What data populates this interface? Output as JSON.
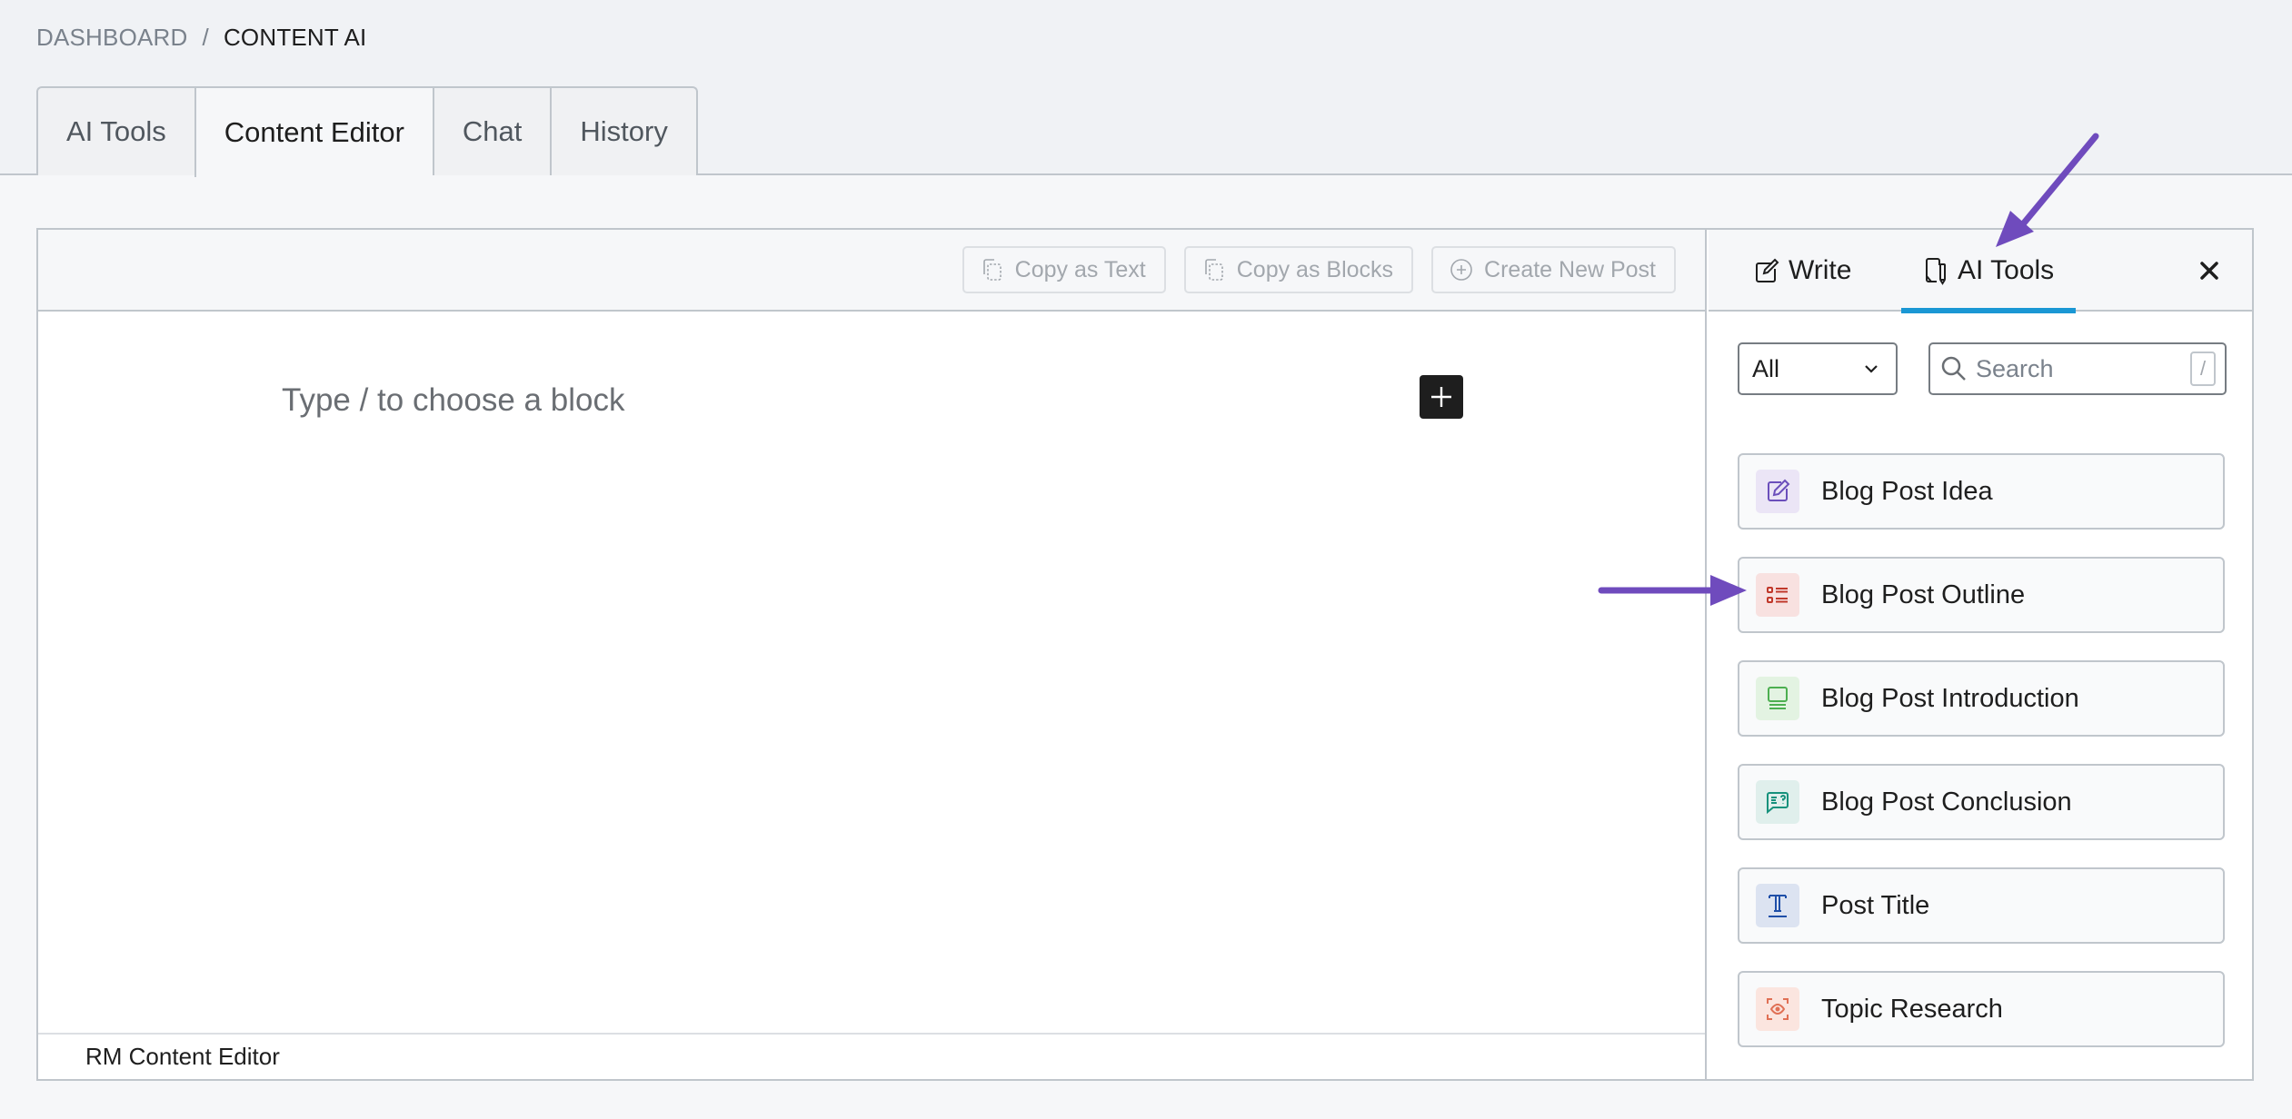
{
  "breadcrumb": {
    "parent": "DASHBOARD",
    "separator": "/",
    "current": "CONTENT AI"
  },
  "tabs": [
    {
      "label": "AI Tools",
      "active": false
    },
    {
      "label": "Content Editor",
      "active": true
    },
    {
      "label": "Chat",
      "active": false
    },
    {
      "label": "History",
      "active": false
    }
  ],
  "editor": {
    "toolbar": {
      "copy_text": "Copy as Text",
      "copy_blocks": "Copy as Blocks",
      "create_post": "Create New Post"
    },
    "placeholder": "Type / to choose a block",
    "add_block_icon": "plus-icon",
    "footer": "RM Content Editor"
  },
  "sidebar": {
    "tabs": {
      "write": "Write",
      "ai_tools": "AI Tools",
      "active": "ai_tools"
    },
    "close_icon": "close-icon",
    "filter": {
      "selected": "All"
    },
    "search": {
      "placeholder": "Search",
      "value": "",
      "shortcut": "/"
    },
    "tools": [
      {
        "label": "Blog Post Idea",
        "icon": "edit-square-icon",
        "color": "#6b4fbb",
        "bg": "#ebe5f6"
      },
      {
        "label": "Blog Post Outline",
        "icon": "list-icon",
        "color": "#c0392b",
        "bg": "#f8e1e0"
      },
      {
        "label": "Blog Post Introduction",
        "icon": "intro-screen-icon",
        "color": "#4caf50",
        "bg": "#e3f3e2"
      },
      {
        "label": "Blog Post Conclusion",
        "icon": "chat-question-icon",
        "color": "#16917c",
        "bg": "#e0efec"
      },
      {
        "label": "Post Title",
        "icon": "text-title-icon",
        "color": "#1f4fa8",
        "bg": "#dce3f1"
      },
      {
        "label": "Topic Research",
        "icon": "eye-scan-icon",
        "color": "#e07055",
        "bg": "#fbe5df"
      }
    ]
  },
  "annotations": {
    "arrow_color": "#6f4bbd"
  }
}
